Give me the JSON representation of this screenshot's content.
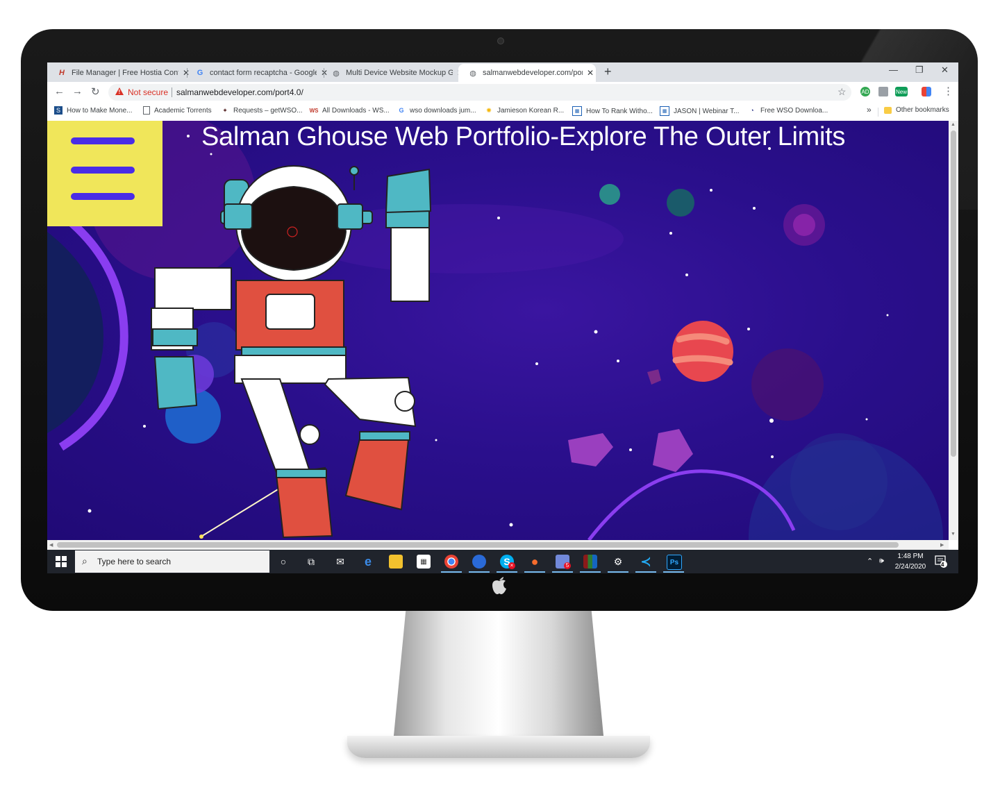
{
  "browser": {
    "tabs": [
      {
        "title": "File Manager | Free Hostia Contro",
        "icon": "hostia-icon"
      },
      {
        "title": "contact form recaptcha - Google",
        "icon": "google-icon"
      },
      {
        "title": "Multi Device Website Mockup Ge",
        "icon": "globe-icon"
      },
      {
        "title": "salmanwebdeveloper.com/port4",
        "icon": "globe-icon"
      }
    ],
    "active_tab": 3,
    "new_tab": "+",
    "window_controls": {
      "minimize": "—",
      "restore": "❐",
      "close": "✕"
    },
    "nav": {
      "back": "←",
      "forward": "→",
      "reload": "↻"
    },
    "security_label": "Not secure",
    "url": "salmanwebdeveloper.com/port4.0/",
    "bookmark_star": "☆",
    "menu": "⋮",
    "extension_new_badge": "New",
    "bookmarks": [
      {
        "label": "How to Make Mone...",
        "icon": "se-icon"
      },
      {
        "label": "Academic Torrents",
        "icon": "page-icon"
      },
      {
        "label": "Requests – getWSO...",
        "icon": "getwso-icon"
      },
      {
        "label": "All Downloads - WS...",
        "icon": "ws-icon"
      },
      {
        "label": "wso downloads jum...",
        "icon": "google-icon"
      },
      {
        "label": "Jamieson Korean R...",
        "icon": "sun-icon"
      },
      {
        "label": "How To Rank Witho...",
        "icon": "grid-icon"
      },
      {
        "label": "JASON | Webinar T...",
        "icon": "grid-icon"
      },
      {
        "label": "Free WSO Downloa...",
        "icon": "swirl-icon"
      }
    ],
    "bookmarks_overflow": "»",
    "other_bookmarks": "Other bookmarks"
  },
  "page": {
    "hero_title": "Salman Ghouse Web Portfolio-Explore The Outer Limits",
    "colors": {
      "background": "#2a0f8c",
      "menu_box": "#f0e65a",
      "menu_bars": "#4a2de6",
      "planet_red": "#e8474f"
    }
  },
  "taskbar": {
    "search_placeholder": "Type here to search",
    "time": "1:48 PM",
    "date": "2/24/2020",
    "notification_count": "4",
    "apps": [
      "cortana",
      "task-view",
      "mail",
      "edge",
      "file-explorer",
      "store",
      "chrome",
      "app-blue",
      "skype",
      "origin",
      "discord",
      "winrar",
      "steam",
      "vscode",
      "photoshop"
    ],
    "skype_badge": "×",
    "discord_badge": "5",
    "photoshop_label": "Ps"
  }
}
